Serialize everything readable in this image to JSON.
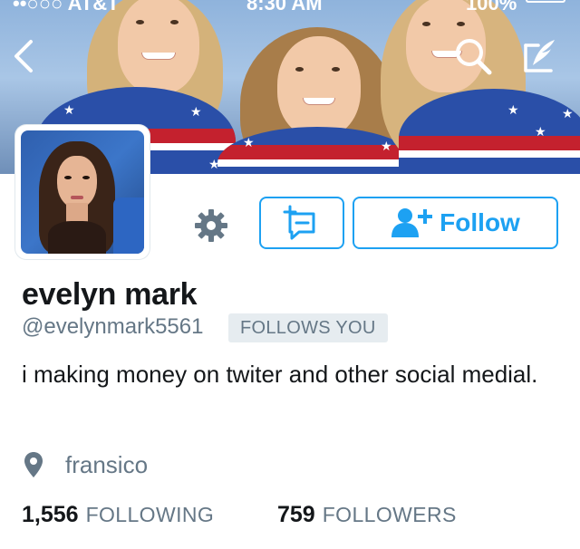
{
  "status_bar": {
    "carrier": "••○○○ AT&T",
    "time": "8:30 AM",
    "battery_percent": "100%"
  },
  "header": {
    "back_icon": "chevron-left-icon",
    "search_icon": "search-icon",
    "compose_icon": "compose-feather-icon",
    "icon_color": "#ffffff"
  },
  "actions": {
    "settings_icon": "gear-icon",
    "message_icon": "direct-message-icon",
    "follow_icon": "add-person-icon",
    "follow_label": "Follow",
    "accent_color": "#1da1f2"
  },
  "profile": {
    "display_name": "evelyn mark",
    "handle": "@evelynmark5561",
    "follows_you_badge": "FOLLOWS YOU",
    "bio": "i making money on twiter and other social medial.",
    "location_icon": "location-pin-icon",
    "location": "fransico"
  },
  "stats": {
    "following_count": "1,556",
    "following_label": "FOLLOWING",
    "followers_count": "759",
    "followers_label": "FOLLOWERS"
  }
}
